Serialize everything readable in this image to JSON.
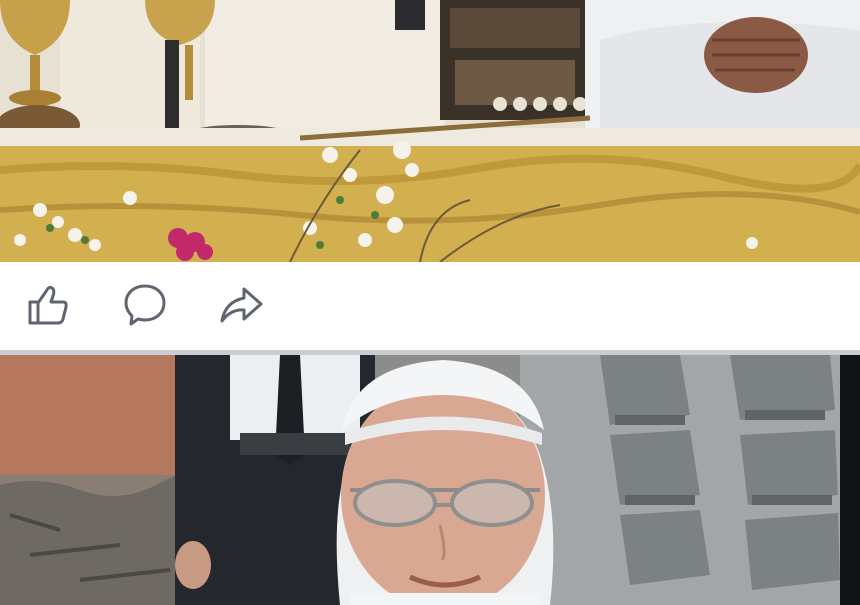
{
  "feed": {
    "posts": [
      {
        "photo": {
          "subject": "altar-scene"
        },
        "actions": [
          {
            "name": "like",
            "icon": "thumbs-up-icon"
          },
          {
            "name": "comment",
            "icon": "comment-bubble-icon"
          },
          {
            "name": "share",
            "icon": "share-arrow-icon"
          }
        ]
      },
      {
        "photo": {
          "subject": "portrait-with-skullcap"
        }
      }
    ]
  },
  "colors": {
    "icon": "#5e6570",
    "divider": "#c9ccd1",
    "background": "#ffffff",
    "altar_cloth": "#d4b253"
  }
}
